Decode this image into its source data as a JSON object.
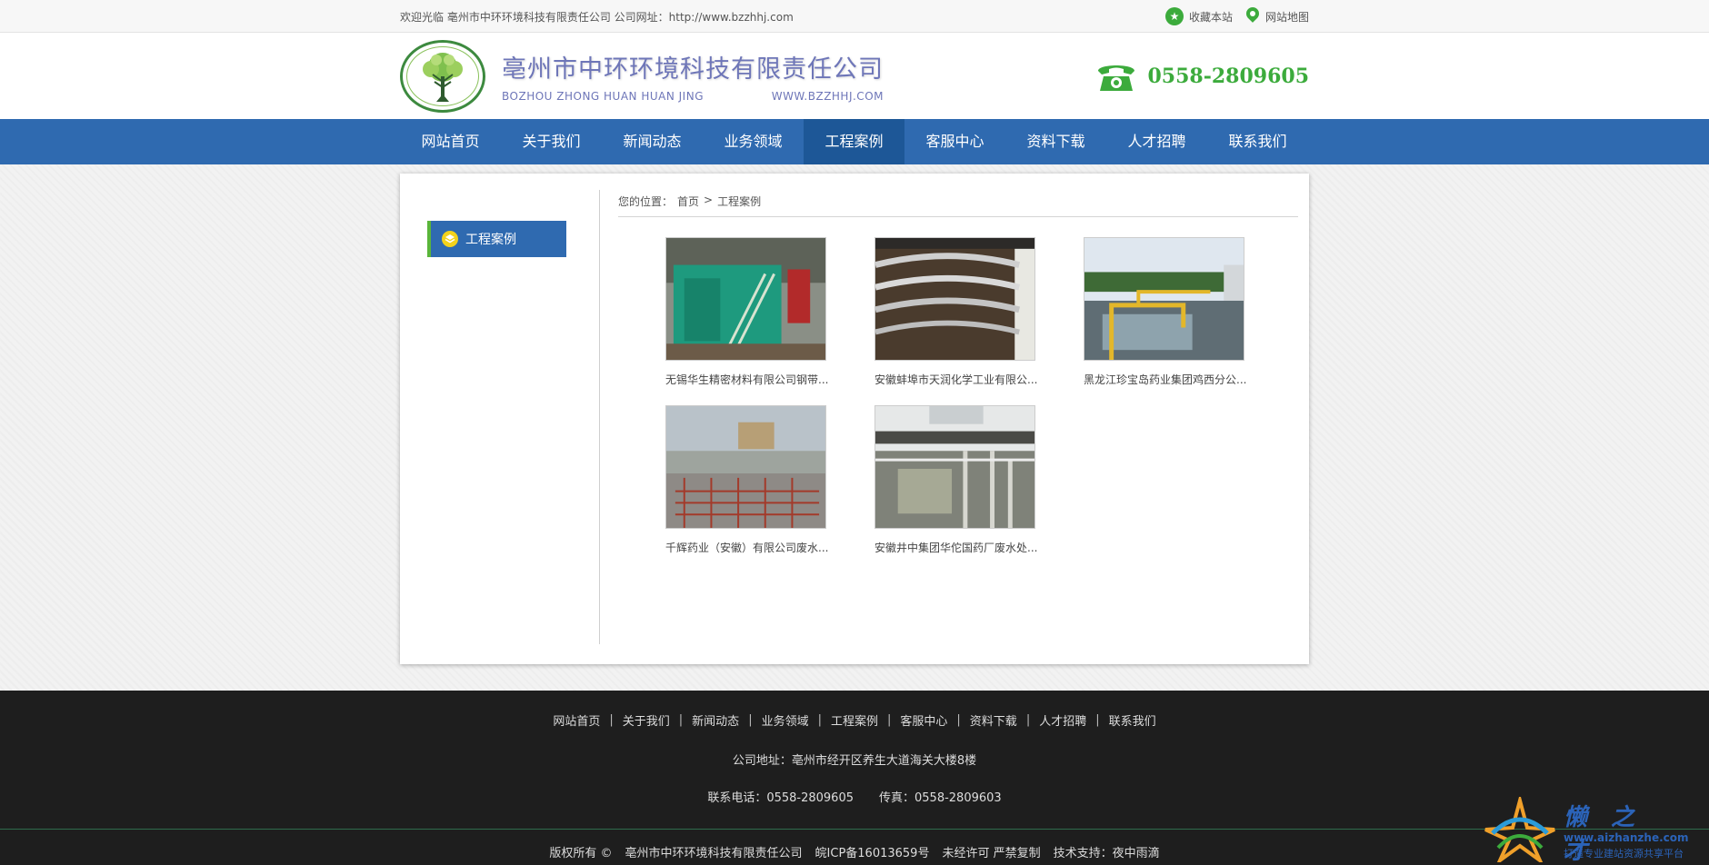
{
  "topbar": {
    "welcome": "欢迎光临 亳州市中环环境科技有限责任公司 公司网址：http://www.bzzhhj.com",
    "favorite": "收藏本站",
    "sitemap": "网站地图"
  },
  "header": {
    "company_cn": "亳州市中环环境科技有限责任公司",
    "company_en": "BOZHOU ZHONG HUAN HUAN JING",
    "website": "WWW.BZZHHJ.COM",
    "phone": "0558-2809605"
  },
  "nav": {
    "items": [
      "网站首页",
      "关于我们",
      "新闻动态",
      "业务领域",
      "工程案例",
      "客服中心",
      "资料下载",
      "人才招聘",
      "联系我们"
    ],
    "active": "工程案例"
  },
  "sidebar": {
    "title": "工程案例"
  },
  "breadcrumb": {
    "prefix": "您的位置：",
    "home": "首页",
    "sep": ">",
    "current": "工程案例"
  },
  "cases": [
    {
      "caption": "无锡华生精密材料有限公司钢带..."
    },
    {
      "caption": "安徽蚌埠市天润化学工业有限公..."
    },
    {
      "caption": "黑龙江珍宝岛药业集团鸡西分公..."
    },
    {
      "caption": "千辉药业（安徽）有限公司废水..."
    },
    {
      "caption": "安徽井中集团华佗国药厂废水处..."
    }
  ],
  "footer": {
    "nav": [
      "网站首页",
      "关于我们",
      "新闻动态",
      "业务领域",
      "工程案例",
      "客服中心",
      "资料下载",
      "人才招聘",
      "联系我们"
    ],
    "address": "公司地址：亳州市经开区养生大道海关大楼8楼",
    "tel": "联系电话：0558-2809605",
    "fax": "传真：0558-2809603",
    "copyright": "版权所有 ©",
    "company": "亳州市中环环境科技有限责任公司",
    "icp": "皖ICP备16013659号",
    "notice": "未经许可 严禁复制",
    "support": "技术支持：夜中雨滴"
  },
  "watermark": {
    "title": "懒之才",
    "url": "www.aizhanzhe.com",
    "slogan": "打造专业建站资源共享平台"
  },
  "colors": {
    "nav": "#2f6ab0",
    "nav_active": "#1d5797",
    "accent_green": "#3cab3c",
    "brand_text": "#6e76b8",
    "footer_bg": "#1e1e1e"
  }
}
